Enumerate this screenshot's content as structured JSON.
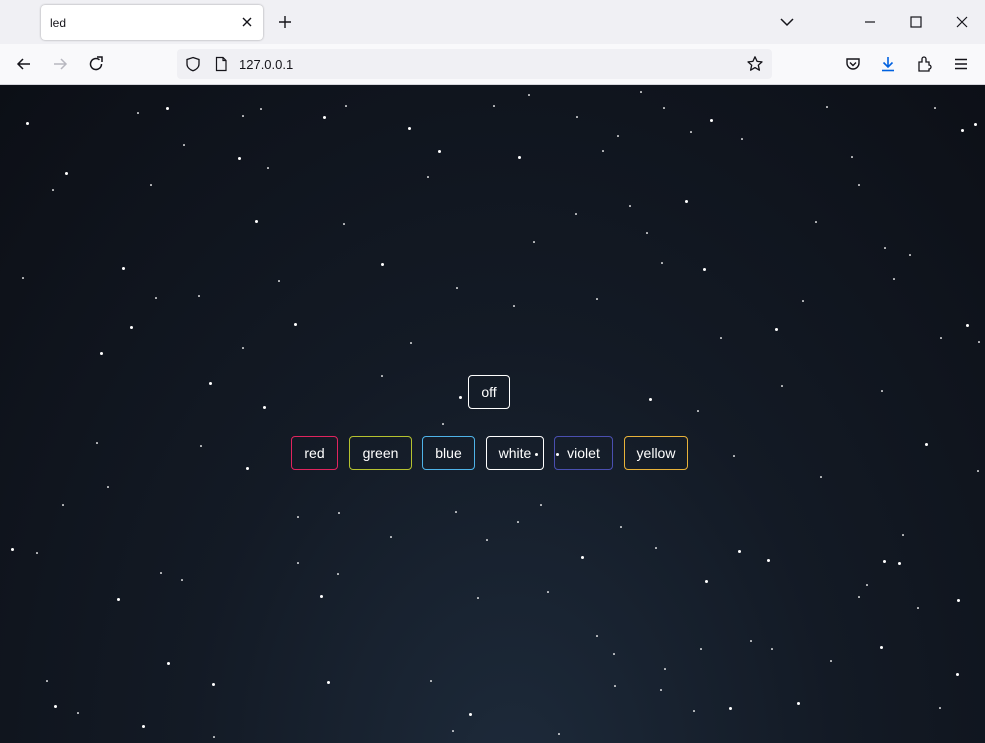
{
  "browser": {
    "tab": {
      "title": "led"
    },
    "url": "127.0.0.1",
    "icons": {
      "tab_close": "close-icon",
      "new_tab": "plus-icon",
      "list_tabs": "chevron-down-icon",
      "back": "back-arrow-icon",
      "forward": "forward-arrow-icon",
      "reload": "reload-icon",
      "shield": "tracking-shield-icon",
      "page": "page-icon",
      "bookmark": "star-icon",
      "pocket": "pocket-icon",
      "downloads": "download-icon",
      "extensions": "extensions-icon",
      "menu": "hamburger-menu-icon"
    },
    "colors": {
      "download_accent": "#0061e0"
    }
  },
  "page": {
    "off_button": {
      "label": "off",
      "color": "#ffffff"
    },
    "color_buttons": [
      {
        "label": "red",
        "color": "#e0245e"
      },
      {
        "label": "green",
        "color": "#b5c22f"
      },
      {
        "label": "blue",
        "color": "#4fb3e8"
      },
      {
        "label": "white",
        "color": "#ffffff"
      },
      {
        "label": "violet",
        "color": "#4a4fb0"
      },
      {
        "label": "yellow",
        "color": "#e8b23a"
      }
    ],
    "colors": {
      "background_top": "#0c0f16",
      "background_bottom": "#1d2a3a",
      "star": "#ffffff"
    }
  }
}
